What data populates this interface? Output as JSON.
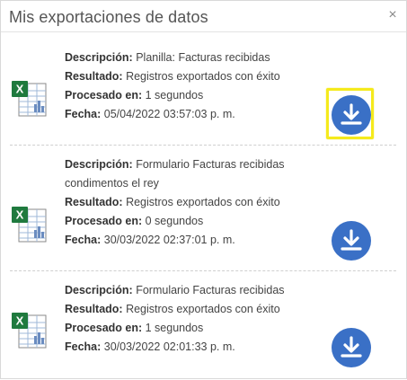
{
  "dialog": {
    "title": "Mis exportaciones de datos",
    "close_symbol": "×"
  },
  "labels": {
    "description": "Descripción:",
    "result": "Resultado:",
    "processed": "Procesado en:",
    "date": "Fecha:"
  },
  "items": [
    {
      "description": "Planilla: Facturas recibidas",
      "result": "Registros exportados con éxito",
      "processed": "1 segundos",
      "date": "05/04/2022 03:57:03 p. m.",
      "file_icon": "excel-file-icon",
      "download_icon": "download-icon",
      "highlighted": true
    },
    {
      "description": "Formulario Facturas recibidas condimentos el rey",
      "result": "Registros exportados con éxito",
      "processed": "0 segundos",
      "date": "30/03/2022 02:37:01 p. m.",
      "file_icon": "excel-file-icon",
      "download_icon": "download-icon",
      "highlighted": false
    },
    {
      "description": "Formulario Facturas recibidas",
      "result": "Registros exportados con éxito",
      "processed": "1 segundos",
      "date": "30/03/2022 02:01:33 p. m.",
      "file_icon": "excel-file-icon",
      "download_icon": "download-icon",
      "highlighted": false
    }
  ],
  "colors": {
    "download_button": "#3a70c6",
    "highlight": "#f5ea1c",
    "excel_green": "#1f7a3e"
  }
}
